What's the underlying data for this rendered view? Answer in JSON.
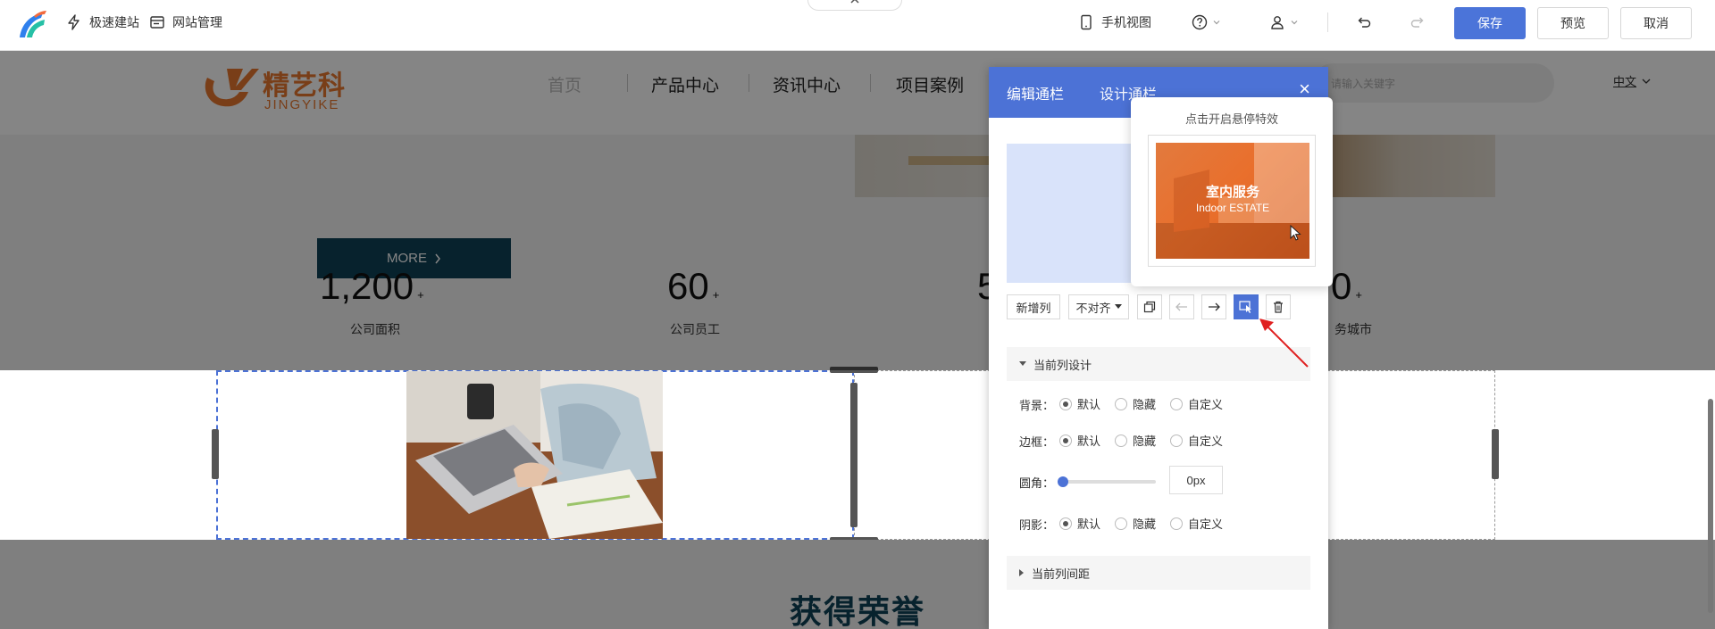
{
  "toolbar": {
    "quick_build": "极速建站",
    "site_manage": "网站管理",
    "mobile_view": "手机视图",
    "save": "保存",
    "preview": "预览",
    "cancel": "取消",
    "collapse": "⌃"
  },
  "site": {
    "logo_cn": "精艺科",
    "logo_en": "JINGYIKE",
    "nav": [
      "首页",
      "产品中心",
      "资讯中心",
      "项目案例"
    ],
    "search_placeholder": "请输入关键字",
    "lang": "中文"
  },
  "hero": {
    "more_button": "MORE"
  },
  "stats": [
    {
      "value": "1,200",
      "plus": "+",
      "label": "公司面积"
    },
    {
      "value": "60",
      "plus": "+",
      "label": "公司员工"
    },
    {
      "value": "5",
      "plus": "",
      "label": ""
    },
    {
      "value": "0",
      "plus": "+",
      "label": "务城市"
    }
  ],
  "honor": {
    "title": "获得荣誉"
  },
  "panel": {
    "tab_edit": "编辑通栏",
    "tab_design": "设计通栏",
    "close": "×",
    "add_column": "新增列",
    "align": "不对齐",
    "section_design": "当前列设计",
    "rows": {
      "background": "背景：",
      "border": "边框：",
      "radius": "圆角：",
      "shadow": "阴影："
    },
    "opt_default": "默认",
    "opt_hide": "隐藏",
    "opt_custom": "自定义",
    "radius_value": "0px",
    "radius_level": 0,
    "section_spacing": "当前列间距"
  },
  "tooltip": {
    "title": "点击开启悬停特效",
    "card_cn": "室内服务",
    "card_en": "Indoor ESTATE"
  },
  "colors": {
    "accent": "#4c72d6",
    "brand_orange": "#e8782f",
    "more_bg": "#0f4257",
    "honor_title": "#0f4257"
  }
}
